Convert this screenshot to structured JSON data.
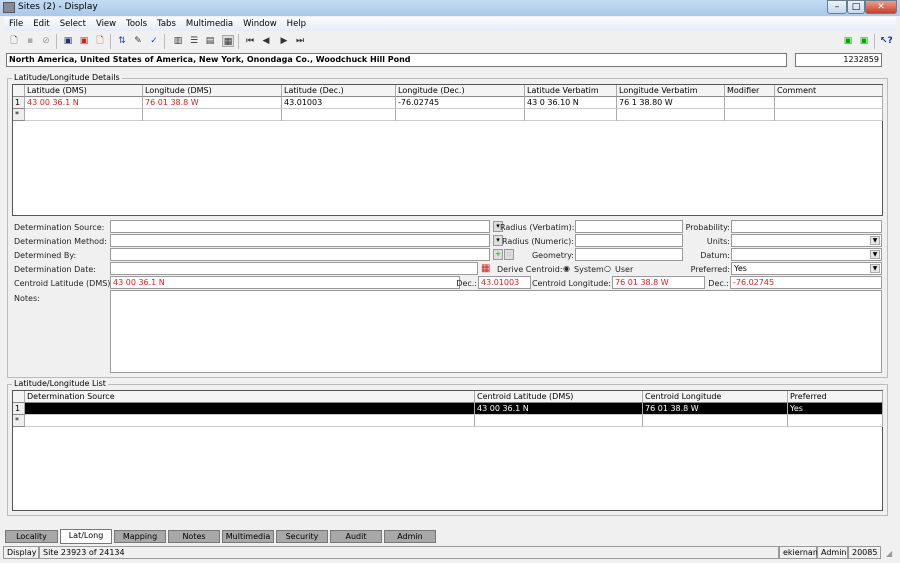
{
  "window": {
    "title": "Sites (2) - Display"
  },
  "menu": [
    "File",
    "Edit",
    "Select",
    "View",
    "Tools",
    "Tabs",
    "Multimedia",
    "Window",
    "Help"
  ],
  "locality_path": "North America, United States of America, New York, Onondaga Co., Woodchuck Hill Pond",
  "record_id": "1232859",
  "details": {
    "group_label": "Latitude/Longitude Details",
    "columns": [
      "Latitude (DMS)",
      "Longitude (DMS)",
      "Latitude (Dec.)",
      "Longitude (Dec.)",
      "Latitude Verbatim",
      "Longitude Verbatim",
      "Modifier",
      "Comment"
    ],
    "rows": [
      {
        "num": "1",
        "cells": [
          "43 00 36.1 N",
          "76 01 38.8 W",
          "43.01003",
          "-76.02745",
          "43 0 36.10 N",
          "76 1 38.80 W",
          "",
          ""
        ]
      }
    ],
    "new_row_marker": "*"
  },
  "form": {
    "determination_source_label": "Determination Source:",
    "determination_source": "",
    "determination_method_label": "Determination Method:",
    "determination_method": "",
    "determined_by_label": "Determined By:",
    "determined_by": "",
    "determination_date_label": "Determination Date:",
    "determination_date": "",
    "centroid_lat_label": "Centroid Latitude (DMS):",
    "centroid_lat": "43 00 36.1 N",
    "notes_label": "Notes:",
    "notes": "",
    "radius_verbatim_label": "Radius (Verbatim):",
    "radius_verbatim": "",
    "radius_numeric_label": "Radius (Numeric):",
    "radius_numeric": "",
    "geometry_label": "Geometry:",
    "geometry": "",
    "derive_centroid_label": "Derive Centroid:",
    "derive_system": "System",
    "derive_user": "User",
    "derive_selected": "System",
    "dec_label": "Dec.:",
    "centroid_lat_dec": "43.01003",
    "centroid_long_label": "Centroid Longitude:",
    "centroid_long": "76 01 38.8 W",
    "dec2_label": "Dec.:",
    "centroid_long_dec": "-76.02745",
    "probability_label": "Probability:",
    "probability": "",
    "units_label": "Units:",
    "units": "",
    "datum_label": "Datum:",
    "datum": "",
    "preferred_label": "Preferred:",
    "preferred": "Yes"
  },
  "list": {
    "group_label": "Latitude/Longitude List",
    "columns": [
      "Determination Source",
      "Centroid Latitude (DMS)",
      "Centroid Longitude",
      "Preferred"
    ],
    "rows": [
      {
        "num": "1",
        "cells": [
          "",
          "43 00 36.1 N",
          "76 01 38.8 W",
          "Yes"
        ]
      }
    ],
    "new_row_marker": "*"
  },
  "tabs": [
    {
      "label": "Locality"
    },
    {
      "label": "Lat/Long",
      "active": true
    },
    {
      "label": "Mapping"
    },
    {
      "label": "Notes"
    },
    {
      "label": "Multimedia"
    },
    {
      "label": "Security"
    },
    {
      "label": "Audit"
    },
    {
      "label": "Admin"
    }
  ],
  "status": {
    "mode": "Display",
    "position": "Site 23923 of 24134",
    "user": "ekiernan",
    "role": "Admin",
    "code": "20085"
  },
  "colors": {
    "value_red": "#e02020",
    "selected_row": "#000000"
  }
}
